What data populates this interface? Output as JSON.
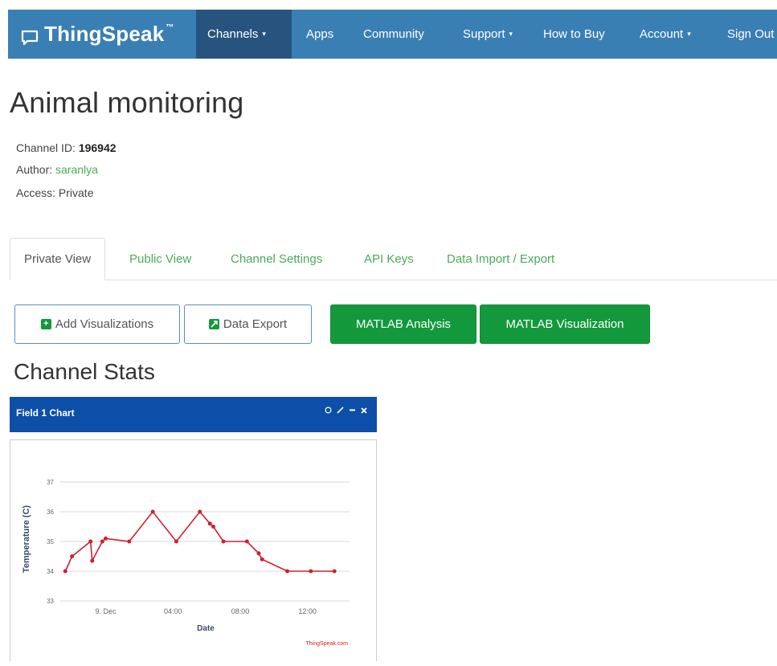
{
  "navbar": {
    "brand": "ThingSpeak",
    "trademark": "™",
    "items": [
      {
        "label": "Channels",
        "has_caret": true,
        "active": true
      },
      {
        "label": "Apps",
        "has_caret": false
      },
      {
        "label": "Community",
        "has_caret": false
      },
      {
        "label": "Support",
        "has_caret": true
      },
      {
        "label": "How to Buy",
        "has_caret": false
      },
      {
        "label": "Account",
        "has_caret": true
      },
      {
        "label": "Sign Out",
        "has_caret": false
      }
    ],
    "caret_glyph": "▾",
    "color": "#3a7fb4",
    "active_color": "#26547e"
  },
  "page": {
    "title": "Animal monitoring",
    "channel_id_label": "Channel ID: ",
    "channel_id": "196942",
    "author_label": "Author: ",
    "author": "saranlya",
    "access_label": "Access: ",
    "access": "Private"
  },
  "tabs": [
    {
      "label": "Private View",
      "active": true
    },
    {
      "label": "Public View"
    },
    {
      "label": "Channel Settings"
    },
    {
      "label": "API Keys"
    },
    {
      "label": "Data Import / Export"
    }
  ],
  "buttons": {
    "add_visualizations": "Add Visualizations",
    "data_export": "Data Export",
    "matlab_analysis": "MATLAB Analysis",
    "matlab_visualization": "MATLAB Visualization"
  },
  "section_title": "Channel Stats",
  "widget": {
    "title": "Field 1 Chart",
    "icons": [
      "comment-icon",
      "edit-icon",
      "minimize-icon",
      "close-icon"
    ],
    "header_color": "#0d4fa8"
  },
  "chart_data": {
    "type": "line",
    "title": "",
    "xlabel": "Date",
    "ylabel": "Temperature (C)",
    "ylim": [
      33,
      37
    ],
    "yticks": [
      "33",
      "34",
      "35",
      "36",
      "37"
    ],
    "xtick_labels": [
      "9. Dec",
      "04:00",
      "08:00",
      "12:00"
    ],
    "xtick_hours": [
      0,
      4,
      8,
      12
    ],
    "xlim_hours": [
      -2.7,
      14.5
    ],
    "grid": true,
    "credit": "ThingSpeak.com",
    "series": [
      {
        "color": "#d0202e",
        "points": [
          {
            "h": -2.4,
            "y": 34
          },
          {
            "h": -2.0,
            "y": 34.5
          },
          {
            "h": -0.9,
            "y": 35
          },
          {
            "h": -0.8,
            "y": 34.35
          },
          {
            "h": -0.2,
            "y": 35
          },
          {
            "h": 0.0,
            "y": 35.1
          },
          {
            "h": 1.4,
            "y": 35
          },
          {
            "h": 2.8,
            "y": 36
          },
          {
            "h": 4.2,
            "y": 35
          },
          {
            "h": 5.6,
            "y": 36
          },
          {
            "h": 6.2,
            "y": 35.6
          },
          {
            "h": 6.4,
            "y": 35.5
          },
          {
            "h": 7.0,
            "y": 35
          },
          {
            "h": 8.4,
            "y": 35
          },
          {
            "h": 9.1,
            "y": 34.6
          },
          {
            "h": 9.3,
            "y": 34.4
          },
          {
            "h": 10.8,
            "y": 34
          },
          {
            "h": 12.2,
            "y": 34
          },
          {
            "h": 13.6,
            "y": 34
          }
        ]
      }
    ]
  }
}
